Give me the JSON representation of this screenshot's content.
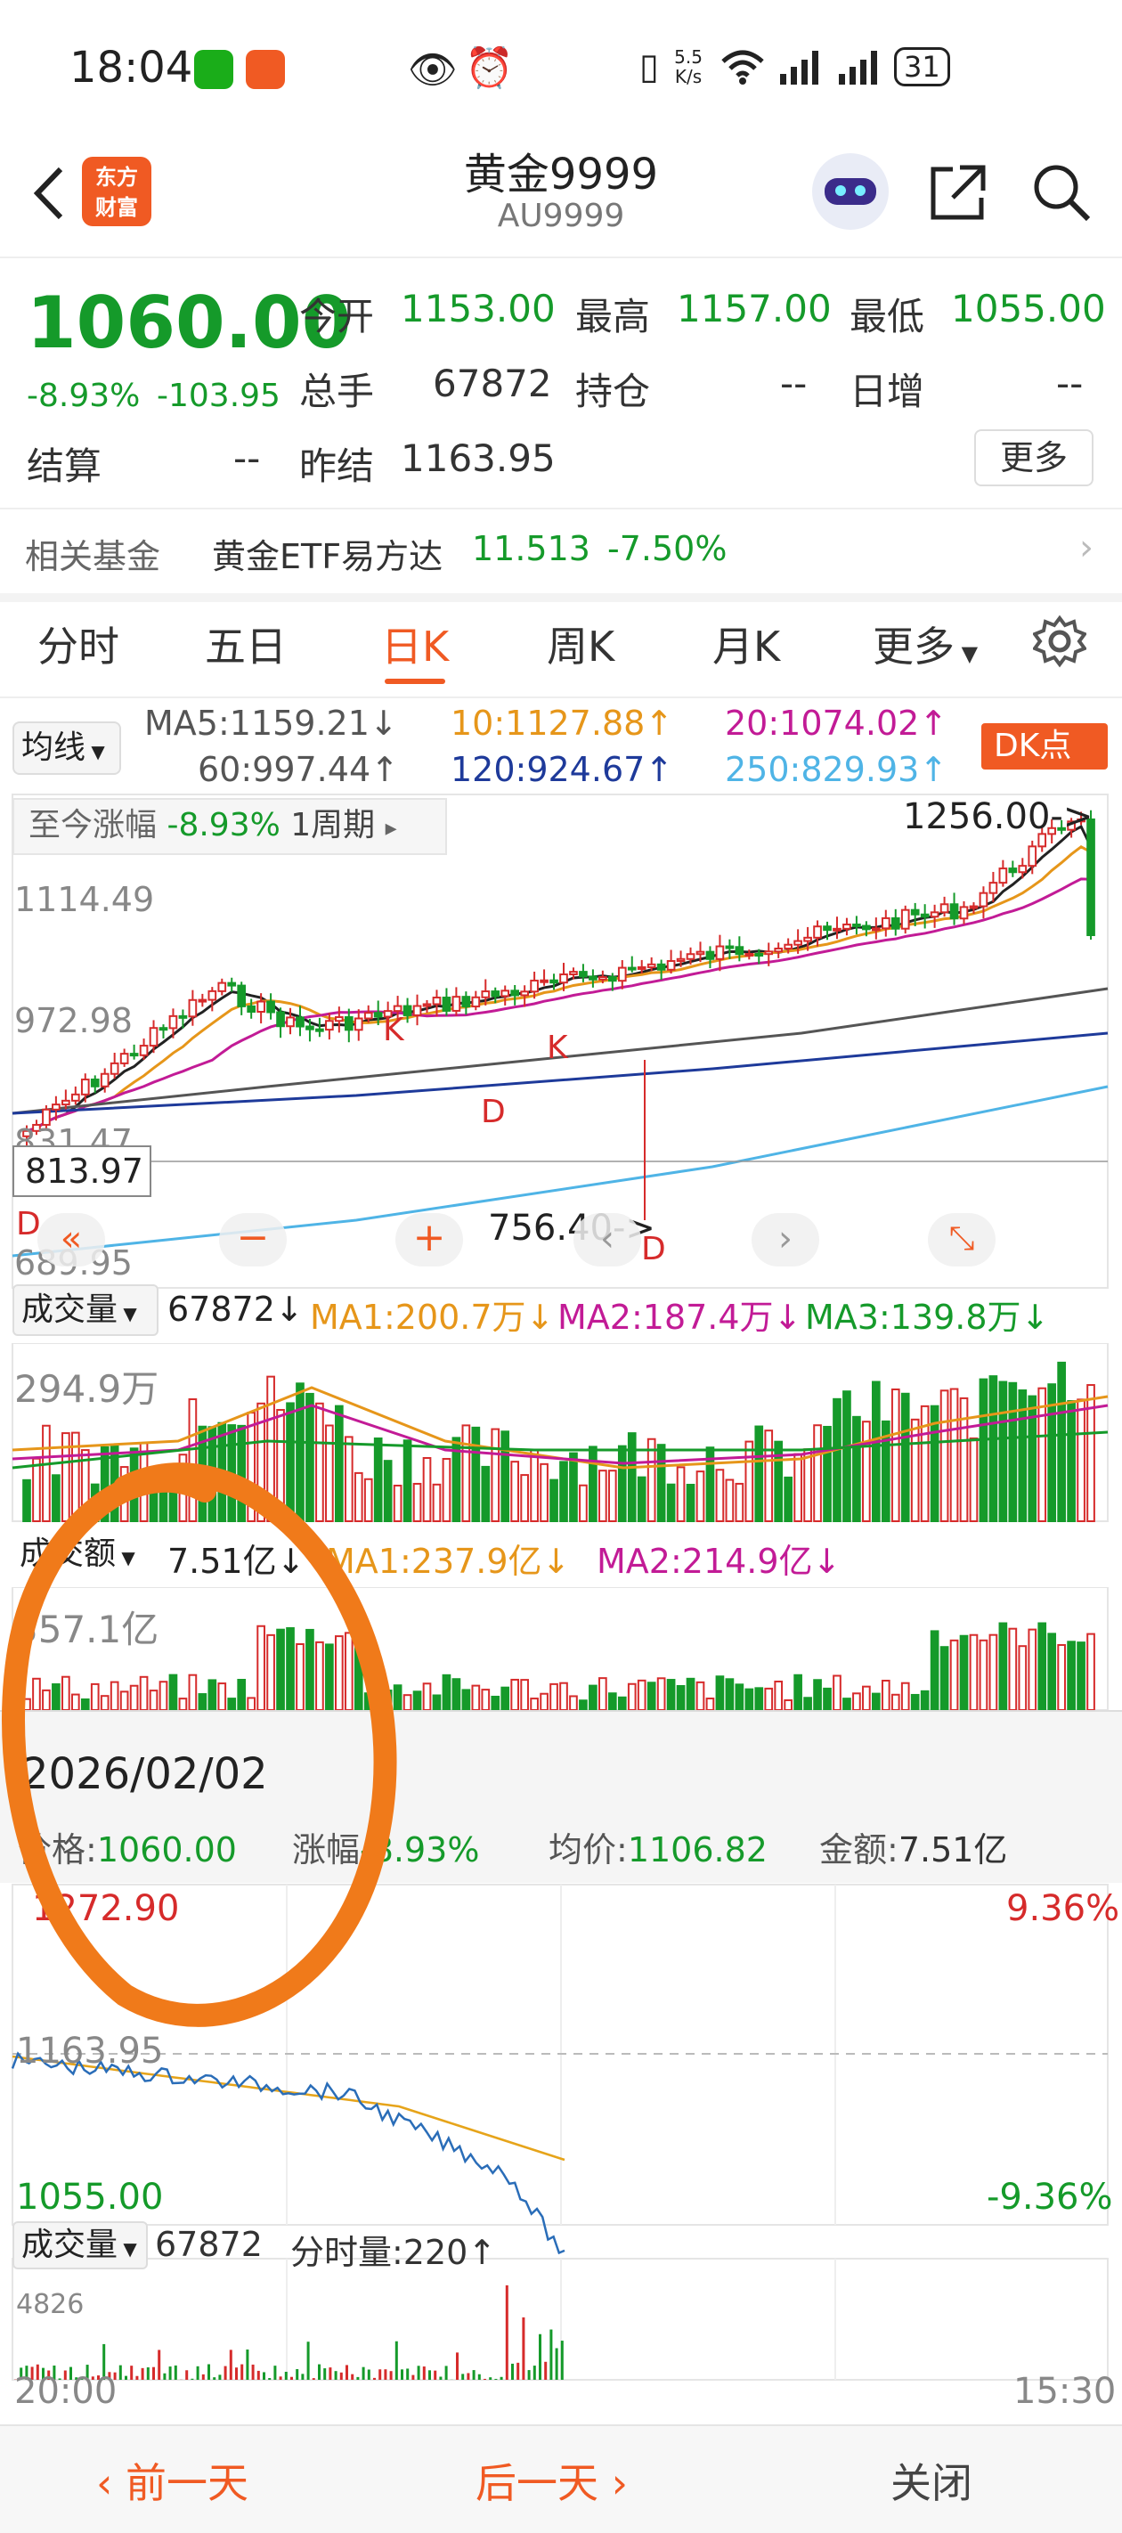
{
  "status_bar": {
    "time": "18:04",
    "net_speed_top": "5.5",
    "net_speed_bottom": "K/s",
    "battery": "31"
  },
  "header": {
    "logo_line1": "东方",
    "logo_line2": "财富",
    "title": "黄金9999",
    "subtitle": "AU9999"
  },
  "quote": {
    "price": "1060.00",
    "change_pct": "-8.93%",
    "change_amt": "-103.95",
    "open_label": "今开",
    "open": "1153.00",
    "high_label": "最高",
    "high": "1157.00",
    "low_label": "最低",
    "low": "1055.00",
    "volume_label": "总手",
    "volume": "67872",
    "position_label": "持仓",
    "position": "--",
    "daily_inc_label": "日增",
    "daily_inc": "--",
    "settle_label": "结算",
    "settle": "--",
    "prev_settle_label": "昨结",
    "prev_settle": "1163.95",
    "more_button": "更多"
  },
  "related_fund": {
    "label": "相关基金",
    "name": "黄金ETF易方达",
    "price": "11.513",
    "change": "-7.50%"
  },
  "tabs": [
    "分时",
    "五日",
    "日K",
    "周K",
    "月K",
    "更多"
  ],
  "active_tab": "日K",
  "ma_legend": {
    "selector": "均线",
    "ma5": "MA5:1159.21↓",
    "ma10": "10:1127.88↑",
    "ma20": "20:1074.02↑",
    "ma60": "60:997.44↑",
    "ma120": "120:924.67↑",
    "ma250": "250:829.93↑",
    "dk_button": "DK点"
  },
  "kline": {
    "period_change_label": "至今涨幅",
    "period_change": "-8.93%",
    "period_label": "1周期",
    "y_ticks": [
      "1114.49",
      "972.98",
      "831.47",
      "689.95"
    ],
    "crosshair_price": "813.97",
    "max_annotation": "1256.00->",
    "min_annotation": "756.40->",
    "markers": [
      "K",
      "K",
      "D",
      "D",
      "D"
    ]
  },
  "volume_panel": {
    "selector": "成交量",
    "value": "67872↓",
    "ma1": "MA1:200.7万↓",
    "ma2": "MA2:187.4万↓",
    "ma3": "MA3:139.8万↓",
    "top_label": "294.9万"
  },
  "amount_panel": {
    "selector": "成交额",
    "value": "7.51亿↓",
    "ma1": "MA1:237.9亿↓",
    "ma2": "MA2:214.9亿↓",
    "top_label": "357.1亿"
  },
  "day_detail": {
    "date": "2026/02/02",
    "price_label": "价格:",
    "price": "1060.00",
    "change_label": "涨幅",
    "change": "-8.93%",
    "avg_label": "均价:",
    "avg": "1106.82",
    "amount_label": "金额:",
    "amount": "7.51亿",
    "high_price": "1272.90",
    "high_pct": "9.36%",
    "ref_price": "1163.95",
    "low_price": "1055.00",
    "low_pct": "-9.36%",
    "vol_selector": "成交量",
    "vol_value": "67872",
    "tick_vol": "分时量:220↑",
    "vol_top": "4826",
    "time_start": "20:00",
    "time_end": "15:30"
  },
  "bottom_nav": {
    "prev": "前一天",
    "next": "后一天",
    "close": "关闭"
  },
  "colors": {
    "up": "#d62b2b",
    "down": "#159a2a",
    "accent": "#f05a23",
    "ma5": "#222222",
    "ma10": "#e6961a",
    "ma20": "#c21b96",
    "ma60": "#555555",
    "ma120": "#1e3a9a",
    "ma250": "#4fb4e6"
  }
}
